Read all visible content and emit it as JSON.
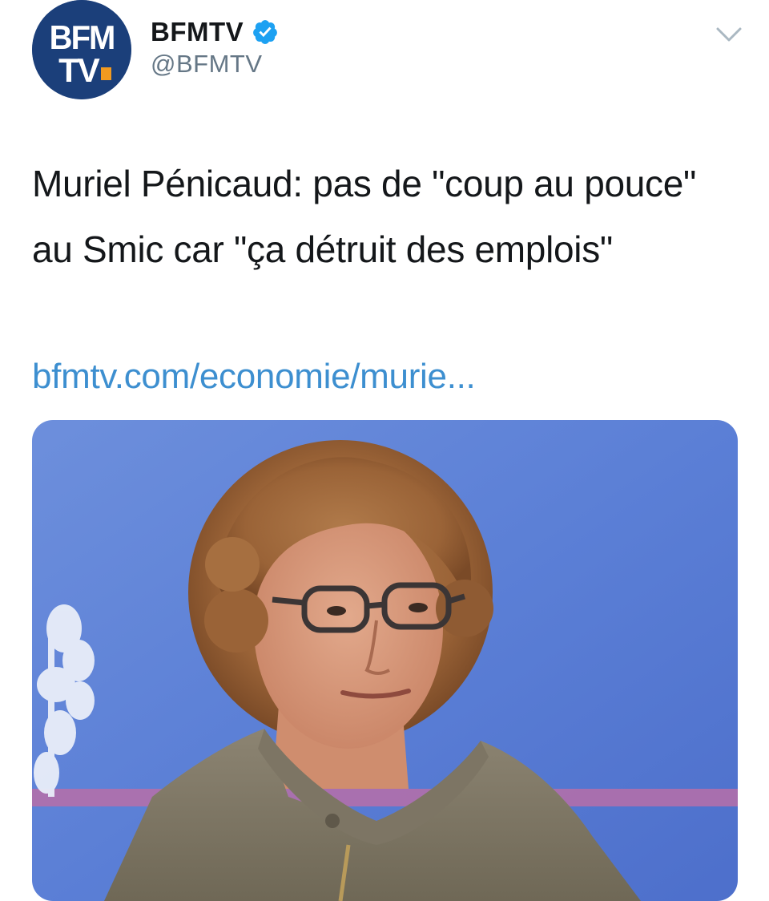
{
  "account": {
    "display_name": "BFMTV",
    "handle": "@BFMTV",
    "verified": true,
    "avatar": {
      "logo_text_top": "BFM",
      "logo_text_bottom": "TV.",
      "background_color": "#1b3f7a",
      "dot_color": "#f29a1f"
    }
  },
  "tweet": {
    "text": "Muriel Pénicaud: pas de \"coup au pouce\" au Smic car \"ça détruit des emplois\"",
    "link": "bfmtv.com/economie/murie..."
  },
  "menu": {
    "icon": "chevron-down-icon"
  },
  "colors": {
    "link": "#3d8fd0",
    "verified": "#1da1f2",
    "text": "#14171a",
    "secondary_text": "#657786",
    "media_background": "#5c7fd4"
  }
}
